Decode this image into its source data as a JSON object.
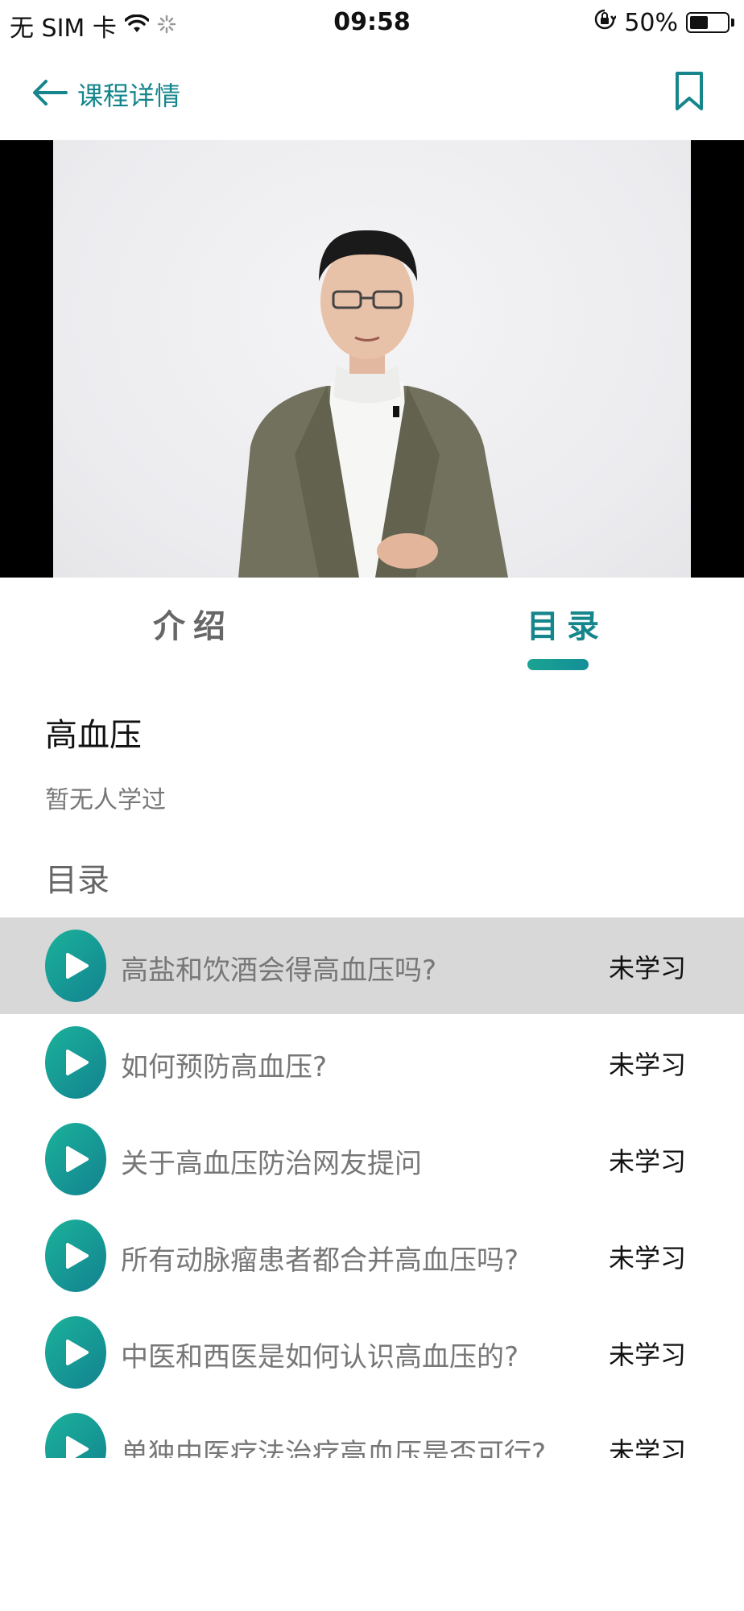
{
  "status_bar": {
    "carrier": "无 SIM 卡",
    "time": "09:58",
    "battery_percent": "50%",
    "battery_level": 0.5
  },
  "nav": {
    "title": "课程详情",
    "back_icon": "arrow-left-icon",
    "bookmark_icon": "bookmark-icon"
  },
  "tabs": [
    {
      "label": "介绍",
      "selected": false
    },
    {
      "label": "目录",
      "selected": true
    }
  ],
  "course": {
    "title": "高血压",
    "learners": "暂无人学过",
    "section_label": "目录"
  },
  "lessons": [
    {
      "title": "高盐和饮酒会得高血压吗?",
      "status": "未学习",
      "active": true
    },
    {
      "title": "如何预防高血压?",
      "status": "未学习",
      "active": false
    },
    {
      "title": "关于高血压防治网友提问",
      "status": "未学习",
      "active": false
    },
    {
      "title": "所有动脉瘤患者都合并高血压吗?",
      "status": "未学习",
      "active": false
    },
    {
      "title": "中医和西医是如何认识高血压的?",
      "status": "未学习",
      "active": false
    },
    {
      "title": "单独中医疗法治疗高血压是否可行?",
      "status": "未学习",
      "active": false
    }
  ],
  "colors": {
    "accent": "#16868c",
    "play_gradient_start": "#1bb29b",
    "play_gradient_end": "#12828f",
    "active_row": "#d8d8d8"
  }
}
